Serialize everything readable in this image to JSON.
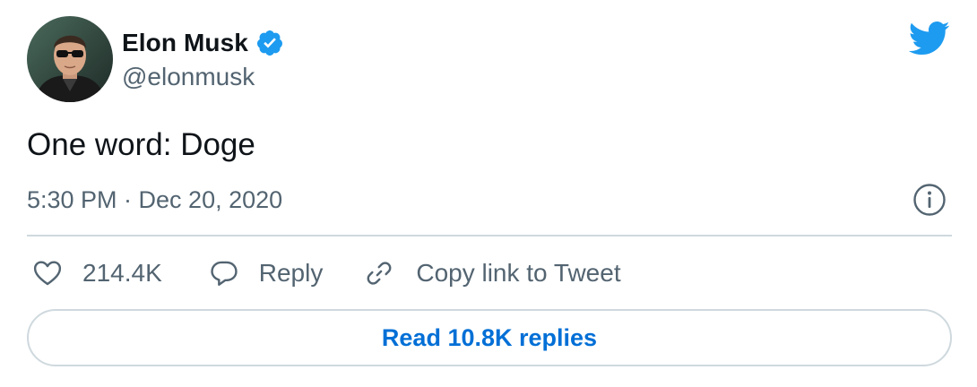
{
  "author": {
    "display_name": "Elon Musk",
    "handle": "@elonmusk",
    "verified": true,
    "avatar_icon": "avatar-photo"
  },
  "tweet": {
    "text": "One word: Doge",
    "timestamp": "5:30 PM · Dec 20, 2020"
  },
  "actions": {
    "like_count": "214.4K",
    "reply_label": "Reply",
    "copy_link_label": "Copy link to Tweet"
  },
  "footer": {
    "read_replies_label": "Read 10.8K replies"
  },
  "icons": {
    "brand": "twitter-bird-icon",
    "verified": "verified-badge-icon",
    "info": "info-icon",
    "like": "heart-icon",
    "reply": "speech-bubble-icon",
    "copy": "link-icon"
  },
  "colors": {
    "brand": "#1d9bf0",
    "link": "#006fd6",
    "text_primary": "#0f1419",
    "text_secondary": "#536471",
    "border": "#cfd9de"
  }
}
